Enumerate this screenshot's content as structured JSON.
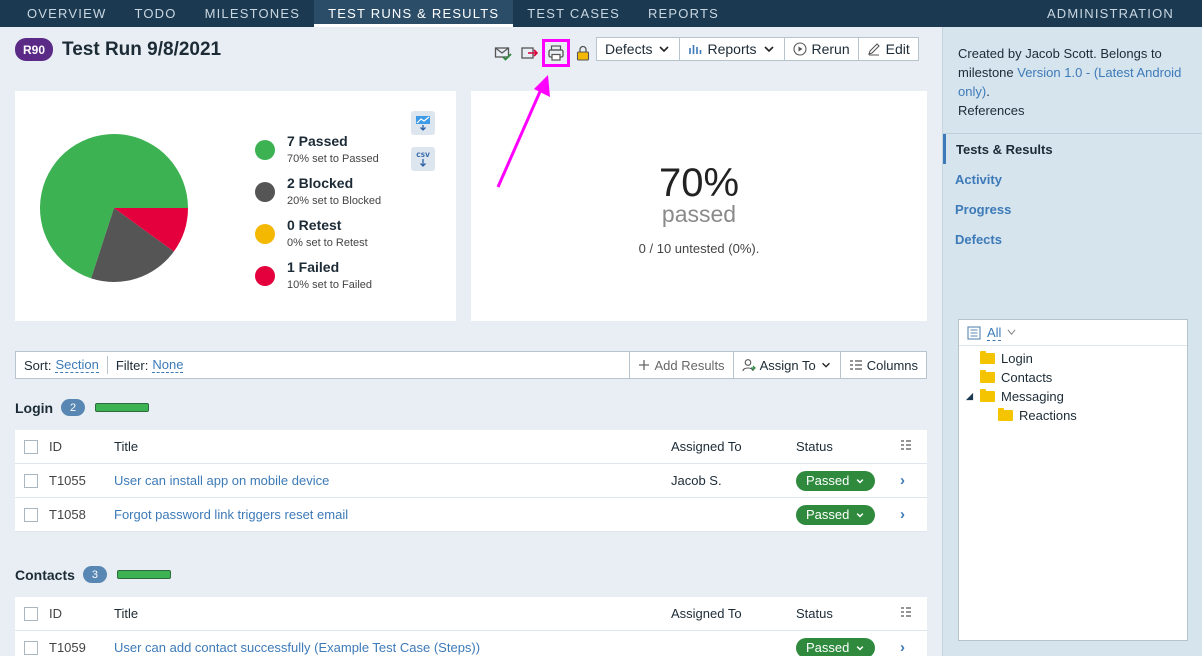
{
  "nav": {
    "tabs": [
      "OVERVIEW",
      "TODO",
      "MILESTONES",
      "TEST RUNS & RESULTS",
      "TEST CASES",
      "REPORTS"
    ],
    "active": "TEST RUNS & RESULTS",
    "admin": "ADMINISTRATION"
  },
  "run": {
    "badge": "R90",
    "title": "Test Run 9/8/2021"
  },
  "toolbar": {
    "defects": "Defects",
    "reports": "Reports",
    "rerun": "Rerun",
    "edit": "Edit"
  },
  "icons": [
    "mail-check-icon",
    "export-icon",
    "print-icon",
    "lock-icon"
  ],
  "chart_data": {
    "type": "pie",
    "slices": [
      {
        "label": "Passed",
        "value": 7,
        "color": "#3db253"
      },
      {
        "label": "Blocked",
        "value": 2,
        "color": "#555555"
      },
      {
        "label": "Retest",
        "value": 0,
        "color": "#f5b800"
      },
      {
        "label": "Failed",
        "value": 1,
        "color": "#e4003c"
      }
    ]
  },
  "legend": [
    {
      "main": "7 Passed",
      "sub": "70% set to Passed",
      "color": "#3db253"
    },
    {
      "main": "2 Blocked",
      "sub": "20% set to Blocked",
      "color": "#555555"
    },
    {
      "main": "0 Retest",
      "sub": "0% set to Retest",
      "color": "#f5b800"
    },
    {
      "main": "1 Failed",
      "sub": "10% set to Failed",
      "color": "#e4003c"
    }
  ],
  "summary": {
    "percent": "70%",
    "label": "passed",
    "untested": "0 / 10 untested (0%)."
  },
  "sortbar": {
    "sort_label": "Sort:",
    "sort_value": "Section",
    "filter_label": "Filter:",
    "filter_value": "None",
    "add_results": "Add Results",
    "assign_to": "Assign To",
    "columns": "Columns"
  },
  "table_header": {
    "id": "ID",
    "title": "Title",
    "assigned": "Assigned To",
    "status": "Status"
  },
  "sections": [
    {
      "name": "Login",
      "count": "2",
      "rows": [
        {
          "id": "T1055",
          "title": "User can install app on mobile device",
          "assigned": "Jacob S.",
          "status": "Passed"
        },
        {
          "id": "T1058",
          "title": "Forgot password link triggers reset email",
          "assigned": "",
          "status": "Passed"
        }
      ]
    },
    {
      "name": "Contacts",
      "count": "3",
      "rows": [
        {
          "id": "T1059",
          "title": "User can add contact successfully (Example Test Case (Steps))",
          "assigned": "",
          "status": "Passed"
        }
      ]
    }
  ],
  "sidebar": {
    "created": "Created by Jacob Scott. Belongs to milestone ",
    "milestone": "Version 1.0 - (Latest Android only)",
    "period": ".",
    "references": "References",
    "nav": [
      "Tests & Results",
      "Activity",
      "Progress",
      "Defects"
    ],
    "tree_all": "All",
    "tree": [
      "Login",
      "Contacts",
      "Messaging",
      "Reactions"
    ]
  }
}
